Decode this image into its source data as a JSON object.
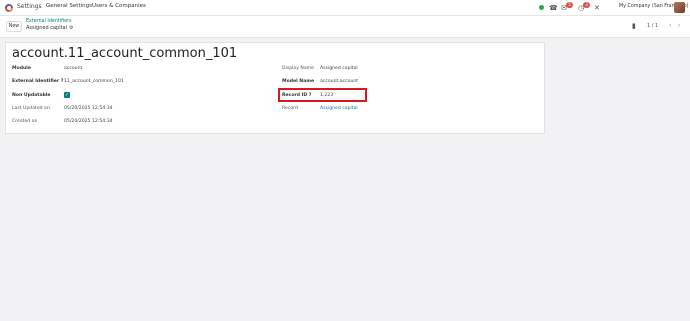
{
  "navbar": {
    "app_name": "Settings",
    "menus": [
      "General Settings",
      "Users & Companies"
    ],
    "chat_count": "5",
    "activity_count": "3",
    "company": "My Company (San Francisco)"
  },
  "control": {
    "new_label": "New",
    "breadcrumb_parent": "External Identifiers",
    "breadcrumb_current": "Assigned capital",
    "pager": "1 / 1"
  },
  "record": {
    "title": "account.11_account_common_101",
    "left": {
      "module_label": "Module",
      "module_value": "account",
      "external_label": "External Identifier ?",
      "external_value": "11_account_common_101",
      "noupdate_label": "Non Updatable",
      "last_updated_label": "Last Updated on",
      "last_updated_value": "05/20/2025 12:54:34",
      "created_label": "Created on",
      "created_value": "05/20/2025 12:54:34"
    },
    "right": {
      "display_name_label": "Display Name",
      "display_name_value": "Assigned capital",
      "model_name_label": "Model Name",
      "model_name_value": "account.account",
      "record_id_label": "Record ID ?",
      "record_id_value": "1,223",
      "record_label": "Record",
      "record_value": "Assigned capital"
    }
  }
}
